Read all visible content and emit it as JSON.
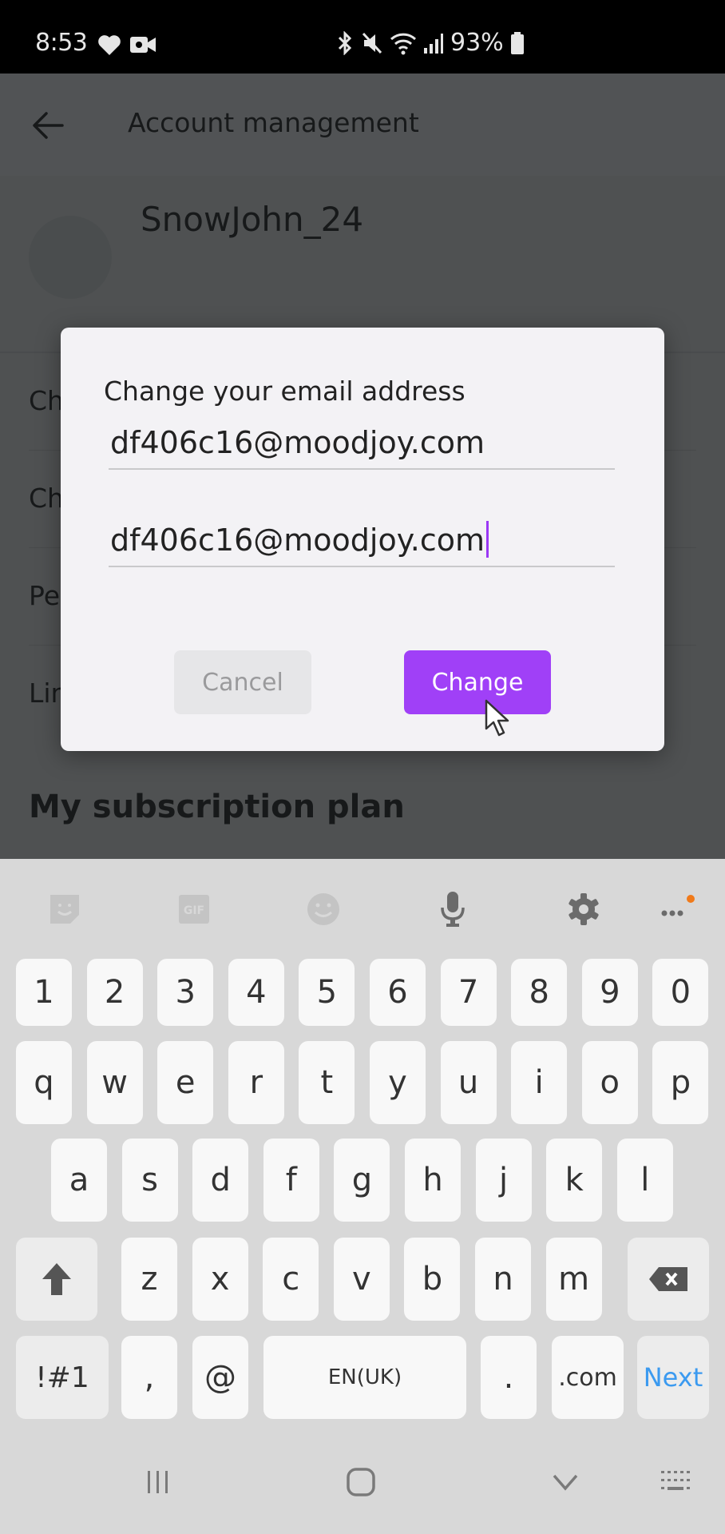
{
  "status_bar": {
    "time": "8:53",
    "left_icons": [
      "heart-monitor-icon",
      "video-camera-icon"
    ],
    "right_icons": [
      "bluetooth-icon",
      "mute-icon",
      "wifi-icon",
      "signal-icon",
      "battery-icon"
    ],
    "battery": "93%"
  },
  "app": {
    "title": "Account management",
    "back_icon": "arrow-left-icon",
    "username": "SnowJohn_24",
    "list_items": [
      {
        "label": "Change email address"
      },
      {
        "label": "Change password"
      },
      {
        "label": "Personal information"
      },
      {
        "label": "Linked accounts"
      }
    ],
    "section_title": "My subscription plan"
  },
  "dialog": {
    "title": "Change your email address",
    "email_value": "df406c16@moodjoy.com",
    "confirm_value": "df406c16@moodjoy.com",
    "cancel_label": "Cancel",
    "change_label": "Change",
    "accent": "#a040f7"
  },
  "keyboard": {
    "toolbar": [
      "sticker-icon",
      "gif-icon",
      "emoji-icon",
      "microphone-icon",
      "settings-icon",
      "more-icon"
    ],
    "rows": [
      [
        "1",
        "2",
        "3",
        "4",
        "5",
        "6",
        "7",
        "8",
        "9",
        "0"
      ],
      [
        "q",
        "w",
        "e",
        "r",
        "t",
        "y",
        "u",
        "i",
        "o",
        "p"
      ],
      [
        "a",
        "s",
        "d",
        "f",
        "g",
        "h",
        "j",
        "k",
        "l"
      ],
      [
        "z",
        "x",
        "c",
        "v",
        "b",
        "n",
        "m"
      ]
    ],
    "bottom": {
      "symbols": "!#1",
      "comma": ",",
      "at": "@",
      "space": "EN(UK)",
      "period": ".",
      "dotcom": ".com",
      "next": "Next"
    }
  },
  "navbar": [
    "recents-icon",
    "home-icon",
    "hide-keyboard-icon",
    "keyboard-switch-icon"
  ]
}
